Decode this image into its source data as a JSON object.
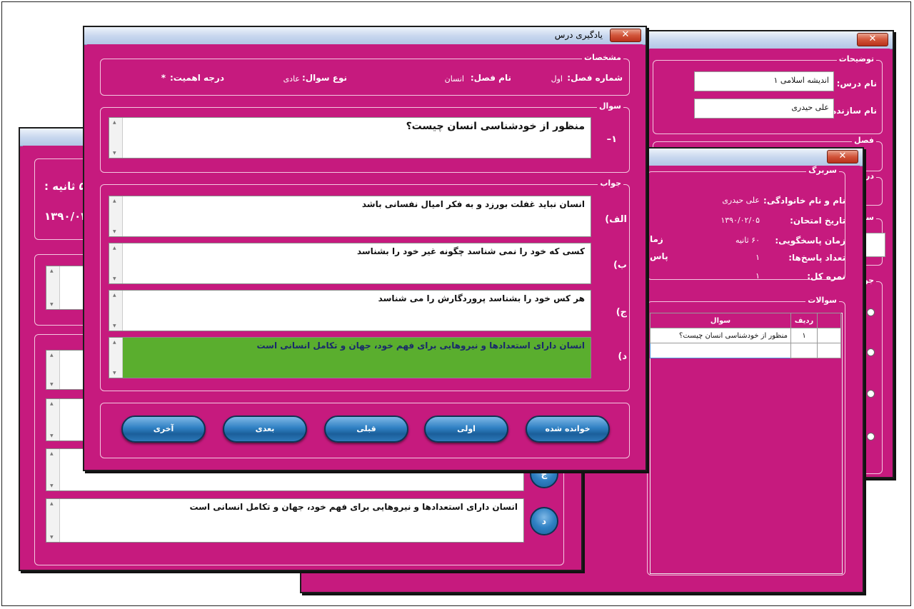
{
  "winA": {
    "group_desc": "توضیحات",
    "course_name_label": "نام درس:",
    "course_name_value": "اندیشه اسلامی ۱",
    "creator_label": "نام سازنده:",
    "creator_value": "علی حیدری",
    "group_chapter": "فصل",
    "group_importance": "درجه",
    "group_question": "سوا",
    "group_answer": "جواب",
    "close": "✕"
  },
  "winB": {
    "group_header": "سربرگ",
    "fullname_label": "نام و نام خانوادگی:",
    "fullname_value": "علی حیدری",
    "exam_date_label": "تاریخ امتحان:",
    "exam_date_value": "۱۳۹۰/۰۲/۰۵",
    "answer_time_label": "زمان پاسخگویی:",
    "answer_time_value": "۶۰ ثانیه",
    "answers_count_label": "تعداد پاسخ‌ها:",
    "answers_count_value": "۱",
    "total_score_label": "نمره کل:",
    "total_score_value": "۱",
    "side_label_1": "زما",
    "side_label_2": "پاس",
    "group_questions": "سوالات",
    "table_headers": [
      "ردیف",
      "سوال"
    ],
    "table_rows": [
      {
        "row": "۱",
        "question": "منظور از خودشناسی انسان چیست؟"
      }
    ],
    "close": "✕"
  },
  "winC": {
    "time_text": "۵۶ ثانیه :",
    "date_text": "۱۳۹۰/۰۲",
    "answer_d": "انسان دارای استعدادها و نیروهایی برای فهم خود، جهان و تکامل انسانی است",
    "circle_c": "ج",
    "circle_d": "د"
  },
  "winD": {
    "title": "یادگیری درس",
    "close": "✕",
    "group_specs": "مشخصات",
    "chapter_no_label": "شماره فصل:",
    "chapter_no_value": "اول",
    "chapter_name_label": "نام فصل:",
    "chapter_name_value": "انسان",
    "qtype_label": "نوع سوال:",
    "qtype_value": "عادی",
    "importance_label": "درجه اهمیت:",
    "importance_value": "*",
    "group_question": "سوال",
    "question_number": "۱–",
    "question_text": "منظور از خودشناسی انسان چیست؟",
    "group_answer": "جواب",
    "options": [
      {
        "label": "الف)",
        "text": "انسان نباید غفلت بورزد و به فکر امیال نفسانی باشد"
      },
      {
        "label": "ب)",
        "text": "کسی که خود را نمی شناسد چگونه غیر خود را بشناسد"
      },
      {
        "label": "ج)",
        "text": "هر کس خود را بشناسد پروردگارش را می شناسد"
      },
      {
        "label": "د)",
        "text": "انسان دارای استعدادها و نیروهایی برای فهم خود، جهان و تکامل انسانی است"
      }
    ],
    "buttons": {
      "read": "خوانده شده",
      "first": "اولی",
      "prev": "قبلی",
      "next": "بعدی",
      "last": "آخری"
    }
  },
  "colors": {
    "window_bg": "#c61a7e",
    "correct_answer": "#5aae2e",
    "button": "#2f80c3"
  }
}
